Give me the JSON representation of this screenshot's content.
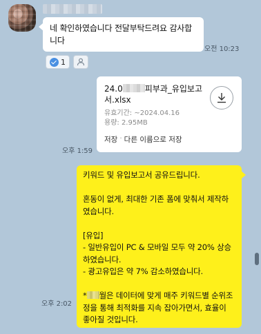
{
  "incoming": {
    "sender_name": "",
    "message": "네 확인하였습니다 전달부탁드려요 감사합니다",
    "time": "오전 10:23",
    "reaction_count": "1"
  },
  "file": {
    "name_prefix": "24.0",
    "name_suffix": "피부과_유입보고서.xlsx",
    "expiry": "유효기간: ~2024.04.16",
    "size": "용량: 2.95MB",
    "save_label": "저장",
    "separator": "·",
    "save_as_label": "다른 이름으로 저장",
    "time": "오후 1:59"
  },
  "outgoing": {
    "line1": "키워드 및 유입보고서 공유드립니다.",
    "line2": "혼동이 없게, 최대한 기존 폼에 맞춰서 제작하였습니다.",
    "line3": "[유입]",
    "line4": "- 일반유입이 PC & 모바일 모두 약 20% 상승하였습니다.",
    "line5": "- 광고유입은 약 7% 감소하였습니다.",
    "line6_prefix": "*",
    "line6_suffix": "월은 데이터에 맞게 매주 키워드별 순위조정을 통해 최적화를 지속 잡아가면서, 효율이 좋아질 것입니다.",
    "time": "오후 2:02"
  },
  "colors": {
    "background": "#b2c7d9",
    "outgoing_bubble": "#fef01b",
    "reaction_check": "#4a90e2"
  }
}
